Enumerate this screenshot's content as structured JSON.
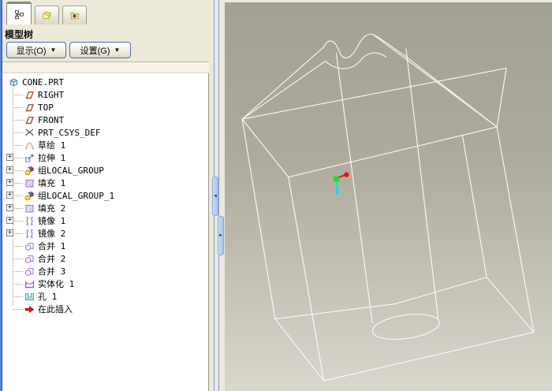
{
  "panel": {
    "tabs": [
      {
        "icon": "model-tree-icon",
        "active": true
      },
      {
        "icon": "folders-icon",
        "active": false
      },
      {
        "icon": "folder-star-icon",
        "active": false
      }
    ],
    "title": "模型树",
    "caret": "▼",
    "buttons": [
      {
        "label": "显示(O)"
      },
      {
        "label": "设置(G)"
      }
    ]
  },
  "tree": {
    "expander_glyph": "+",
    "items": [
      {
        "label": "CONE.PRT",
        "icon": "part-icon",
        "expandable": false
      },
      {
        "label": "RIGHT",
        "icon": "datum-plane-icon",
        "expandable": false
      },
      {
        "label": "TOP",
        "icon": "datum-plane-icon",
        "expandable": false
      },
      {
        "label": "FRONT",
        "icon": "datum-plane-icon",
        "expandable": false
      },
      {
        "label": "PRT_CSYS_DEF",
        "icon": "csys-icon",
        "expandable": false
      },
      {
        "label": "草绘 1",
        "icon": "sketch-icon",
        "expandable": false
      },
      {
        "label": "拉伸 1",
        "icon": "extrude-icon",
        "expandable": true
      },
      {
        "label": "组LOCAL_GROUP",
        "icon": "group-icon",
        "expandable": true
      },
      {
        "label": "填充 1",
        "icon": "fill-icon",
        "expandable": true
      },
      {
        "label": "组LOCAL_GROUP_1",
        "icon": "group-icon",
        "expandable": true
      },
      {
        "label": "填充 2",
        "icon": "fill-icon",
        "expandable": true
      },
      {
        "label": "镜像 1",
        "icon": "mirror-icon",
        "expandable": true
      },
      {
        "label": "镜像 2",
        "icon": "mirror-icon",
        "expandable": true
      },
      {
        "label": "合并 1",
        "icon": "merge-icon",
        "expandable": false
      },
      {
        "label": "合并 2",
        "icon": "merge-icon",
        "expandable": false
      },
      {
        "label": "合并 3",
        "icon": "merge-icon",
        "expandable": false
      },
      {
        "label": "实体化 1",
        "icon": "solidify-icon",
        "expandable": false
      },
      {
        "label": "孔 1",
        "icon": "hole-icon",
        "expandable": false
      },
      {
        "label": "在此插入",
        "icon": "insert-here-icon",
        "expandable": false
      }
    ]
  },
  "splitter": {
    "collapse_left": "◄",
    "collapse_right": "►"
  },
  "viewport": {
    "background_top": "#a4a093",
    "background_bottom": "#dad7cd",
    "wireframe_color": "#ffffff",
    "triad": {
      "x_axis_color": "#ee1111",
      "y_axis_color": "#1ddd2a",
      "z_axis_color": "#00e0ee"
    }
  }
}
